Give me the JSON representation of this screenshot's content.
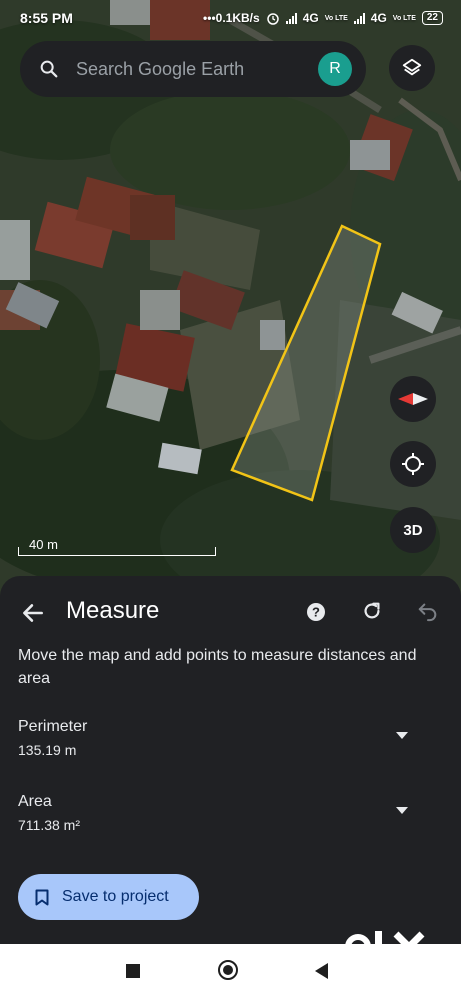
{
  "status_bar": {
    "time": "8:55 PM",
    "net_speed": "0.1KB/s",
    "network1": "4G",
    "network2": "4G",
    "lte_label": "Vo LTE",
    "battery": "22"
  },
  "search": {
    "placeholder": "Search Google Earth",
    "avatar_letter": "R"
  },
  "map": {
    "scale_label": "40 m",
    "btn_3d": "3D",
    "outline_color": "#f2c417"
  },
  "measure": {
    "title": "Measure",
    "instruction": "Move the map and add points to measure distances and area",
    "perimeter_label": "Perimeter",
    "perimeter_value": "135.19 m",
    "area_label": "Area",
    "area_value": "711.38 m²",
    "save_label": "Save to project"
  },
  "colors": {
    "sheet_bg": "#202124",
    "accent_button": "#a8c7fa",
    "avatar": "#1a9e8f"
  },
  "icons": [
    "search-icon",
    "layers-icon",
    "compass-icon",
    "my-location-icon",
    "back-arrow-icon",
    "help-icon",
    "reset-icon",
    "undo-icon",
    "chevron-down-icon",
    "bookmark-icon"
  ]
}
